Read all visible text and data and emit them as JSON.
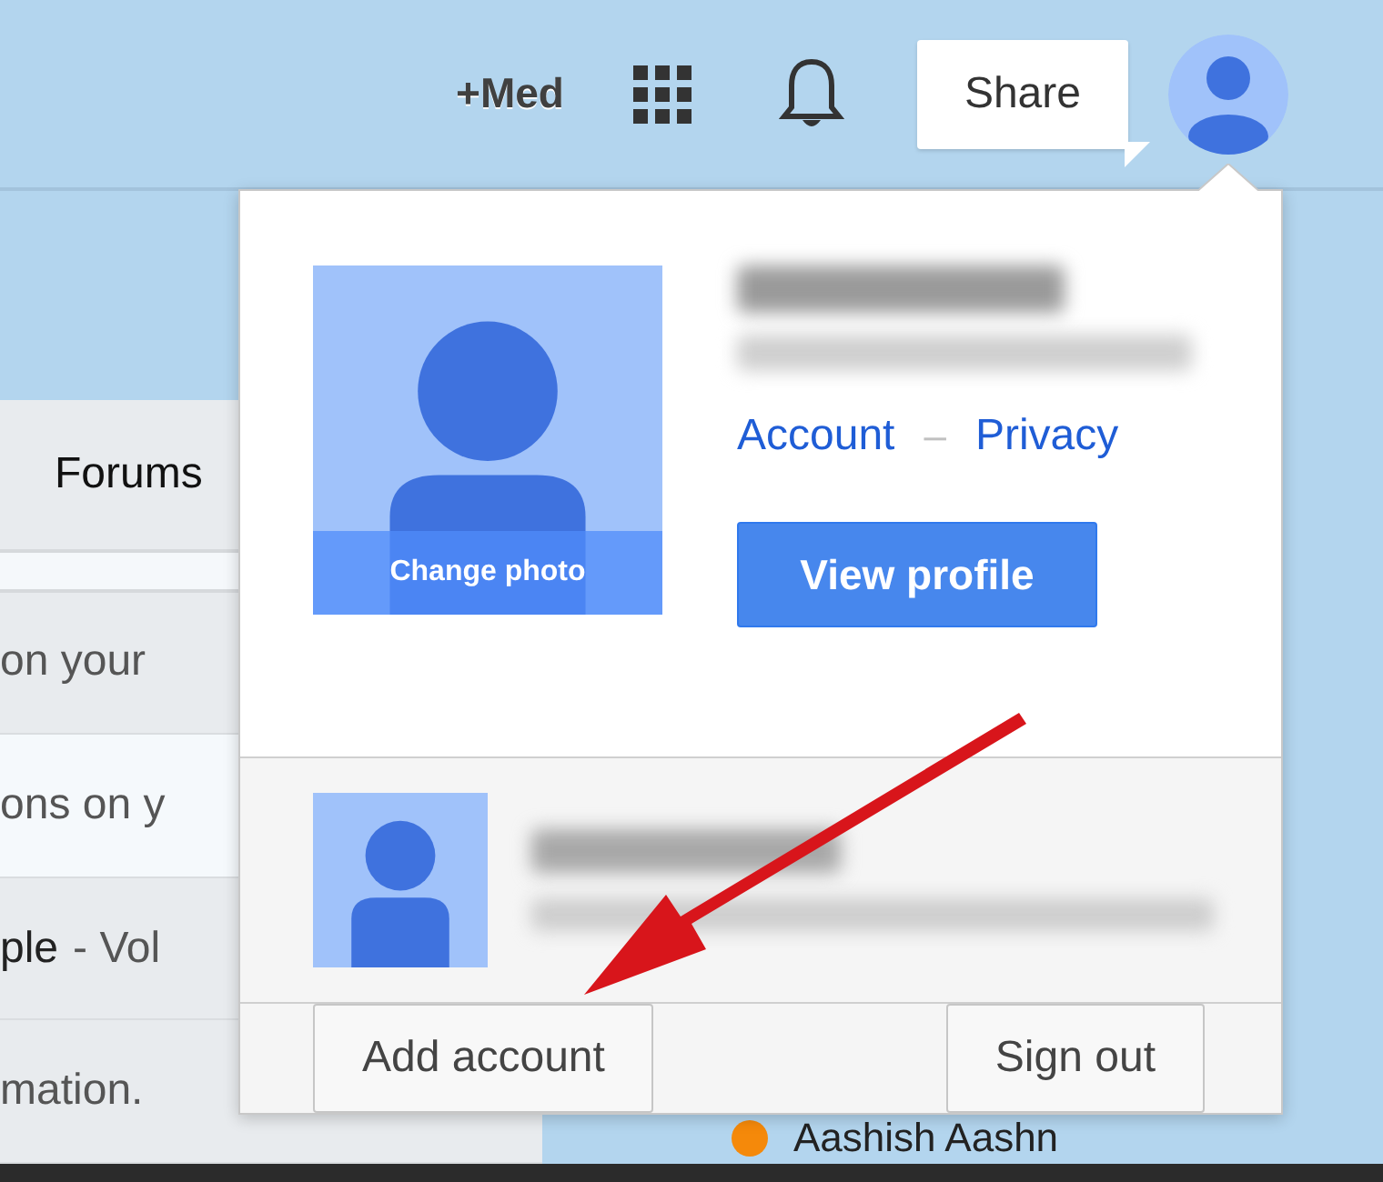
{
  "header": {
    "plus_link": "+Med",
    "share_button": "Share"
  },
  "side_panel": {
    "tab": "Forums",
    "rows": [
      {
        "text": "on your",
        "selected": false
      },
      {
        "text": "ons on y",
        "selected": true
      },
      {
        "text": "ple",
        "suffix": "- Vol",
        "selected": false
      },
      {
        "text": "mation.",
        "selected": false
      }
    ]
  },
  "contact": {
    "name": "Aashish Aashn",
    "color": "#f5890a"
  },
  "account_menu": {
    "change_photo": "Change photo",
    "links": [
      "Account",
      "Privacy"
    ],
    "separator": "–",
    "view_profile": "View profile",
    "add_account": "Add account",
    "sign_out": "Sign out"
  }
}
